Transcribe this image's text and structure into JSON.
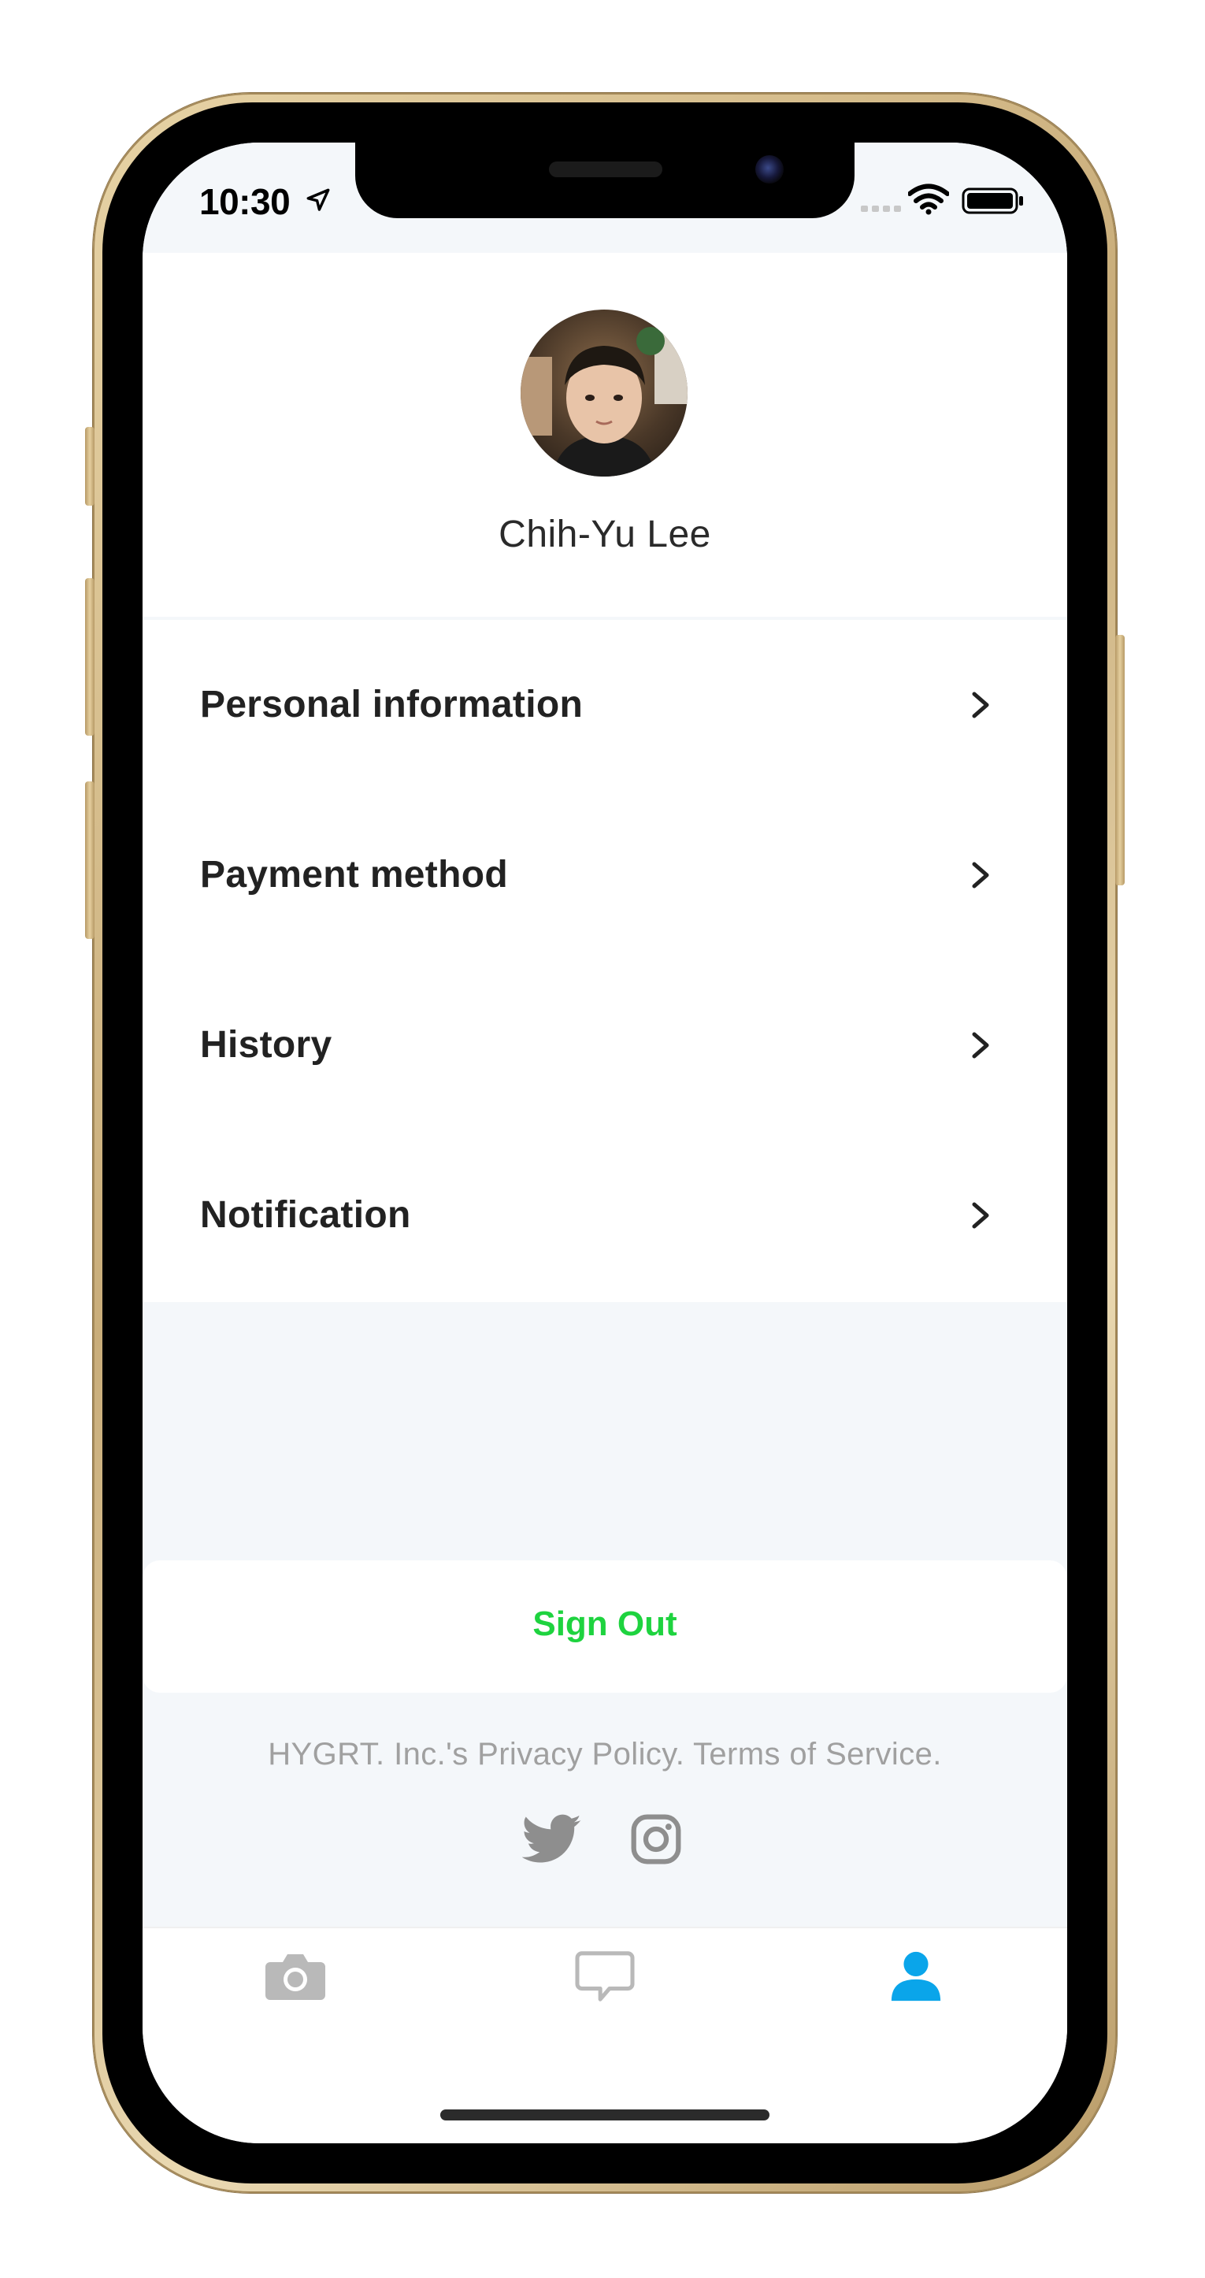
{
  "status_bar": {
    "time": "10:30",
    "icons": [
      "location-arrow-icon",
      "cellular-dots-icon",
      "wifi-icon",
      "battery-icon"
    ]
  },
  "profile": {
    "name": "Chih-Yu Lee",
    "avatar": "profile-photo"
  },
  "menu": {
    "items": [
      {
        "label": "Personal information",
        "icon": "chevron-right-icon"
      },
      {
        "label": "Payment method",
        "icon": "chevron-right-icon"
      },
      {
        "label": "History",
        "icon": "chevron-right-icon"
      },
      {
        "label": "Notification",
        "icon": "chevron-right-icon"
      }
    ]
  },
  "sign_out": {
    "label": "Sign Out"
  },
  "footer": {
    "text": "HYGRT. Inc.'s Privacy Policy. Terms of Service.",
    "social_icons": [
      "twitter-icon",
      "instagram-icon"
    ]
  },
  "tab_bar": {
    "tabs": [
      {
        "icon": "camera-icon",
        "active": false
      },
      {
        "icon": "chat-bubble-icon",
        "active": false
      },
      {
        "icon": "person-icon",
        "active": true
      }
    ]
  },
  "colors": {
    "accent_green": "#1ed33f",
    "active_tab_blue": "#0aa5ea",
    "inactive_tab_gray": "#b9b9b9",
    "background": "#f4f7fa"
  }
}
